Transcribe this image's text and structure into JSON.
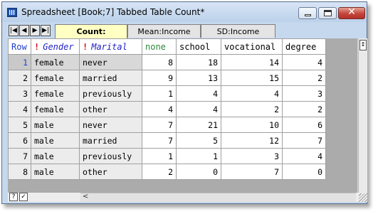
{
  "window": {
    "title": "Spreadsheet [Book;7] Tabbed Table Count*"
  },
  "nav": {
    "first": "|◀",
    "prev": "◀",
    "next": "▶",
    "last": "▶|"
  },
  "tabs": [
    {
      "label": "Count:",
      "active": true
    },
    {
      "label": "Mean:Income",
      "active": false
    },
    {
      "label": "SD:Income",
      "active": false
    }
  ],
  "table": {
    "headers": {
      "row": "Row",
      "gender": "Gender",
      "marital": "Marital",
      "none": "none",
      "school": "school",
      "vocational": "vocational",
      "degree": "degree"
    },
    "rows": [
      {
        "row": "1",
        "gender": "female",
        "marital": "never",
        "none": "8",
        "school": "18",
        "vocational": "14",
        "degree": "4"
      },
      {
        "row": "2",
        "gender": "female",
        "marital": "married",
        "none": "9",
        "school": "13",
        "vocational": "15",
        "degree": "2"
      },
      {
        "row": "3",
        "gender": "female",
        "marital": "previously",
        "none": "1",
        "school": "4",
        "vocational": "4",
        "degree": "3"
      },
      {
        "row": "4",
        "gender": "female",
        "marital": "other",
        "none": "4",
        "school": "4",
        "vocational": "2",
        "degree": "2"
      },
      {
        "row": "5",
        "gender": "male",
        "marital": "never",
        "none": "7",
        "school": "21",
        "vocational": "10",
        "degree": "6"
      },
      {
        "row": "6",
        "gender": "male",
        "marital": "married",
        "none": "7",
        "school": "5",
        "vocational": "12",
        "degree": "7"
      },
      {
        "row": "7",
        "gender": "male",
        "marital": "previously",
        "none": "1",
        "school": "1",
        "vocational": "3",
        "degree": "4"
      },
      {
        "row": "8",
        "gender": "male",
        "marital": "other",
        "none": "2",
        "school": "0",
        "vocational": "7",
        "degree": "0"
      }
    ]
  },
  "statusbar": {
    "help": "?",
    "check": "✓"
  },
  "colors": {
    "window_frame": "#c6d8ee",
    "active_tab": "#ffffc4",
    "factor_marker": "#d4102a",
    "header_blue": "#1f3fcc",
    "none_header": "#2a8a3a"
  }
}
